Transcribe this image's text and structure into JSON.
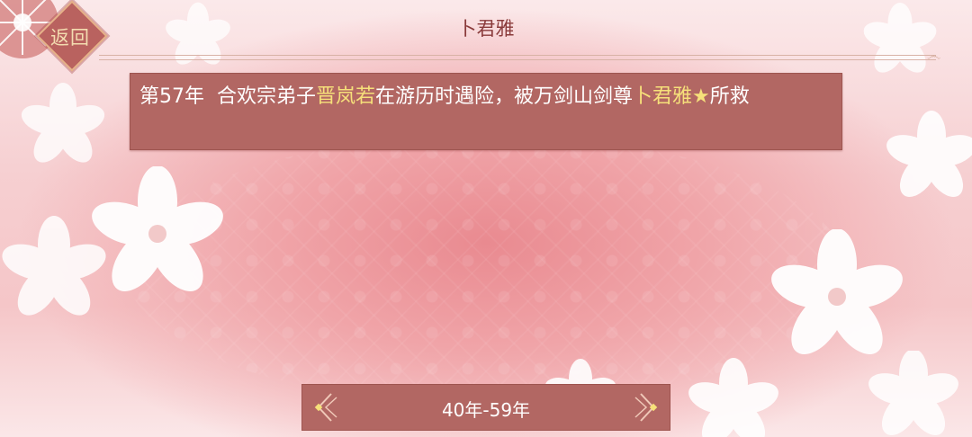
{
  "header": {
    "back_label": "返回",
    "title": "卜君雅"
  },
  "event": {
    "year": "第57年",
    "text_a": "合欢宗弟子",
    "person_a": "晋岚若",
    "text_b": "在游历时遇险，被万剑山剑尊",
    "person_b": "卜君雅★",
    "text_c": "所救"
  },
  "period": {
    "label": "40年-59年"
  },
  "colors": {
    "panel": "#b26763",
    "highlight": "#f6e07a",
    "title_text": "#8a3b3b",
    "back_button": "#b9625f"
  },
  "icons": {
    "prev": "chevron-left-icon",
    "next": "chevron-right-icon"
  }
}
